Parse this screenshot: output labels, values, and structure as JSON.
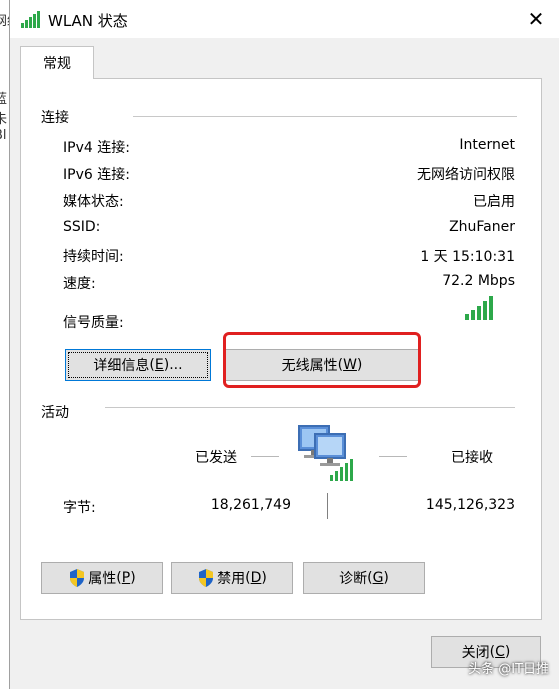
{
  "background_window": {
    "fragments": [
      "网络",
      "蓝",
      "未",
      "Bl"
    ]
  },
  "window": {
    "title": "WLAN 状态",
    "close_glyph": "✕"
  },
  "tabs": [
    {
      "label": "常规"
    }
  ],
  "connection": {
    "title": "连接",
    "rows": [
      {
        "label": "IPv4 连接:",
        "value": "Internet"
      },
      {
        "label": "IPv6 连接:",
        "value": "无网络访问权限"
      },
      {
        "label": "媒体状态:",
        "value": "已启用"
      },
      {
        "label": "SSID:",
        "value": "ZhuFaner"
      },
      {
        "label": "持续时间:",
        "value": "1 天 15:10:31"
      },
      {
        "label": "速度:",
        "value": "72.2 Mbps"
      }
    ],
    "signal_label": "信号质量:",
    "signal_icon": "signal-strength-icon",
    "signal_bars": 5,
    "signal_bars_filled": 5
  },
  "buttons": {
    "details": {
      "label": "详细信息",
      "access": "E",
      "suffix": "..."
    },
    "wireless": {
      "label": "无线属性",
      "access": "W"
    },
    "properties": {
      "label": "属性",
      "access": "P"
    },
    "disable": {
      "label": "禁用",
      "access": "D"
    },
    "diagnose": {
      "label": "诊断",
      "access": "G"
    },
    "close": {
      "label": "关闭",
      "access": "C"
    }
  },
  "activity": {
    "title": "活动",
    "sent_label": "已发送",
    "received_label": "已接收",
    "bytes_label": "字节:",
    "bytes_sent": "18,261,749",
    "bytes_received": "145,126,323"
  },
  "watermark": "头条 @IT日推",
  "colors": {
    "accent_highlight": "#e02020",
    "signal_green": "#2da84a",
    "shield_blue": "#1e64c8",
    "shield_yellow": "#f3c623"
  }
}
